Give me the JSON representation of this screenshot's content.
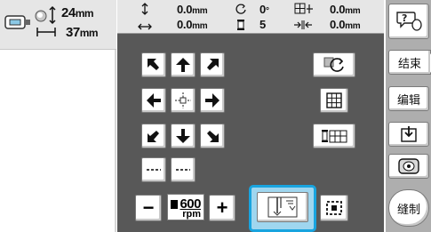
{
  "pattern_size": {
    "height": {
      "value": "24",
      "unit": "mm"
    },
    "width": {
      "value": "37",
      "unit": "mm"
    }
  },
  "status": {
    "offset_v": {
      "value": "0.0",
      "unit": "mm"
    },
    "offset_h": {
      "value": "0.0",
      "unit": "mm"
    },
    "angle": {
      "value": "0",
      "unit": "°"
    },
    "thread_color_count": "5",
    "density_v": {
      "value": "0.0",
      "unit": "mm"
    },
    "density_h": {
      "value": "0.0",
      "unit": "mm"
    }
  },
  "speed": {
    "value": "600",
    "unit": "rpm"
  },
  "buttons": {
    "minus": "−",
    "plus": "+",
    "end": "结束",
    "edit": "编辑",
    "sew": "缝制"
  },
  "icons": {
    "help": "help-icon",
    "hoop": "hoop-icon",
    "needle": "needle-start-icon",
    "colors": "color-list-icon"
  },
  "colors": {
    "panel": "#585858",
    "highlight": "#18a4df",
    "right_column": "#aeaeae"
  }
}
